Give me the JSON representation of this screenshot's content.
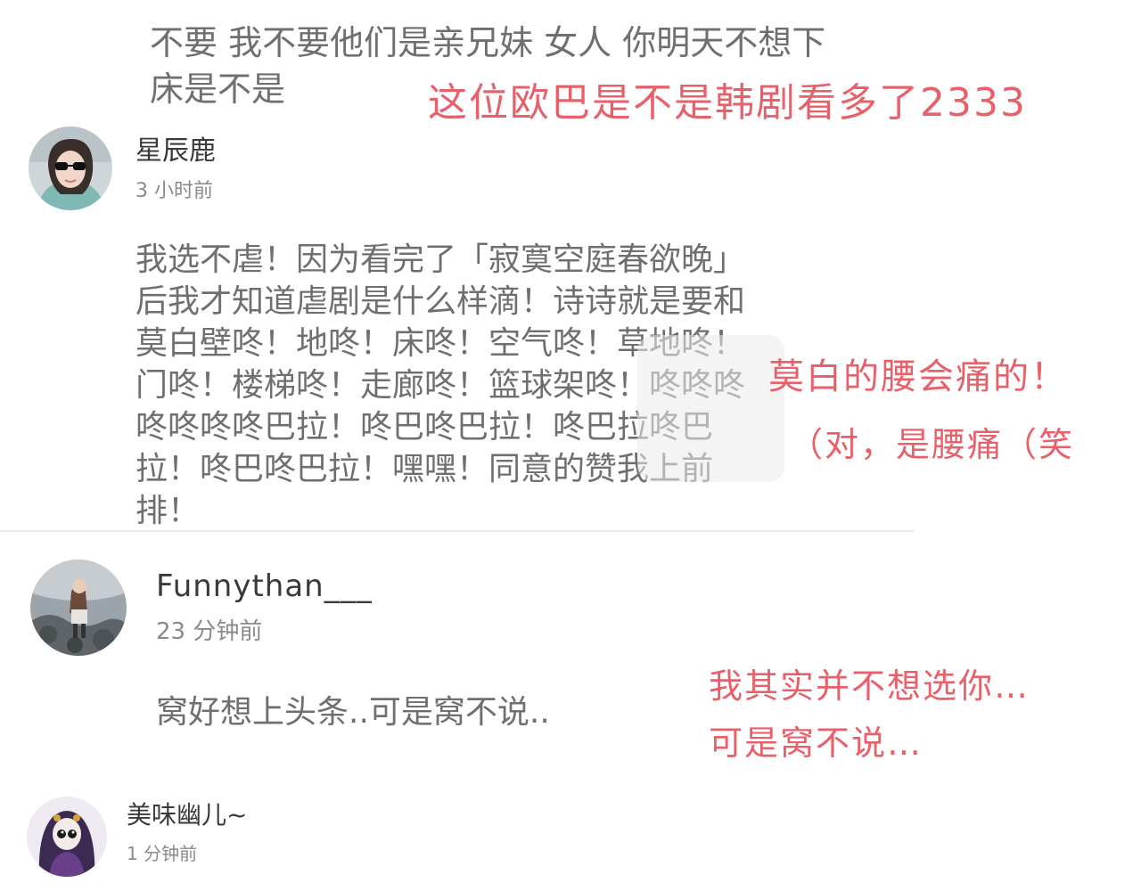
{
  "comments": [
    {
      "text": "不要 我不要他们是亲兄妹 女人 你明天不想下床是不是"
    },
    {
      "username": "星辰鹿",
      "time": "3 小时前",
      "text": "我选不虐！因为看完了「寂寞空庭春欲晚」后我才知道虐剧是什么样滴！诗诗就是要和莫白壁咚！地咚！床咚！空气咚！草地咚！门咚！楼梯咚！走廊咚！篮球架咚！咚咚咚咚咚咚咚巴拉！咚巴咚巴拉！咚巴拉咚巴拉！咚巴咚巴拉！嘿嘿！同意的赞我上前排！"
    },
    {
      "username": "Funnythan___",
      "time": "23 分钟前",
      "text": "窝好想上头条..可是窝不说.."
    },
    {
      "username": "美味幽儿~",
      "time": "1 分钟前"
    }
  ],
  "annotations": [
    "这位欧巴是不是韩剧看多了2333",
    "莫白的腰会痛的！",
    "（对，是腰痛（笑",
    "我其实并不想选你…",
    "可是窝不说…"
  ],
  "icons": {
    "avatar1": "avatar-woman-sunglasses",
    "avatar2": "avatar-girl-on-rocks",
    "avatar3": "avatar-anime-girl-purple"
  },
  "colors": {
    "annotation": "#e8606a",
    "comment_text": "#6f6f6f",
    "username": "#3a3a3a",
    "timestamp": "#8a8a8a"
  }
}
